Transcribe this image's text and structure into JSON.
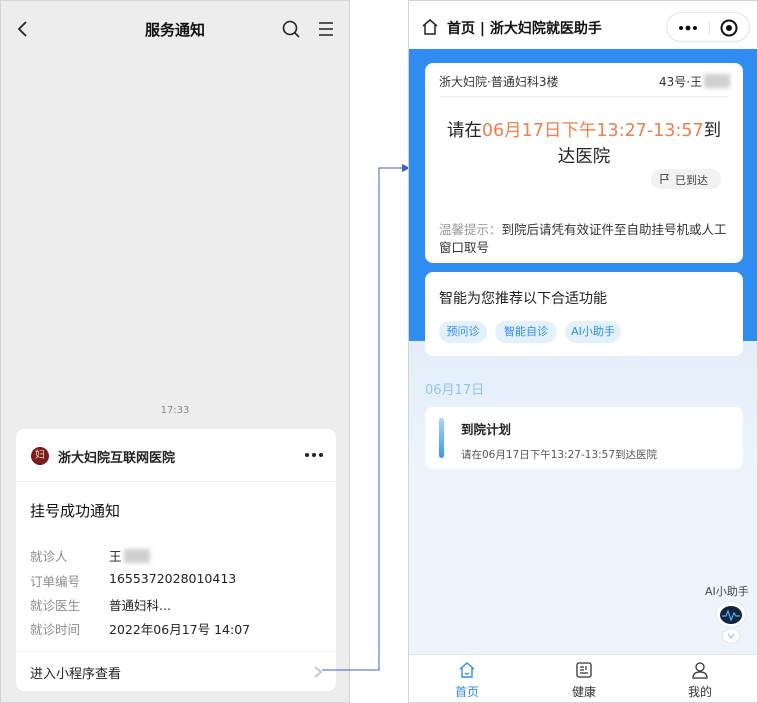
{
  "left": {
    "header": {
      "title": "服务通知"
    },
    "timestamp": "17:33",
    "card": {
      "hospital_name": "浙大妇院互联网医院",
      "logo_glyph": "妇",
      "title": "挂号成功通知",
      "fields": [
        {
          "label": "就诊人",
          "value": "王"
        },
        {
          "label": "订单编号",
          "value": "1655372028010413"
        },
        {
          "label": "就诊医生",
          "value": "普通妇科..."
        },
        {
          "label": "就诊时间",
          "value": "2022年06月17号 14:07"
        }
      ],
      "enter_label": "进入小程序查看"
    }
  },
  "right": {
    "header": {
      "title": "首页 | 浙大妇院就医助手"
    },
    "appointment": {
      "dept": "浙大妇院·普通妇科3楼",
      "number": "43号·王",
      "line_prefix": "请在",
      "time_range": "06月17日下午13:27-13:57",
      "line_suffix": "到达医院",
      "arrived_label": "已到达",
      "tip_prefix": "温馨提示：",
      "tip_text": "到院后请凭有效证件至自助挂号机或人工窗口取号"
    },
    "recommend": {
      "title": "智能为您推荐以下合适功能",
      "chips": [
        "预问诊",
        "智能自诊",
        "AI小助手"
      ]
    },
    "date": "06月17日",
    "plan": {
      "title": "到院计划",
      "subtitle": "请在06月17日下午13:27-13:57到达医院"
    },
    "ai_assistant_label": "AI小助手",
    "tabs": [
      {
        "label": "首页",
        "icon": "home-icon",
        "active": true
      },
      {
        "label": "健康",
        "icon": "health-icon",
        "active": false
      },
      {
        "label": "我的",
        "icon": "profile-icon",
        "active": false
      }
    ]
  },
  "colors": {
    "accent_blue": "#2f8cf0",
    "time_orange": "#f07f4b",
    "connector": "#3b5fc9"
  }
}
